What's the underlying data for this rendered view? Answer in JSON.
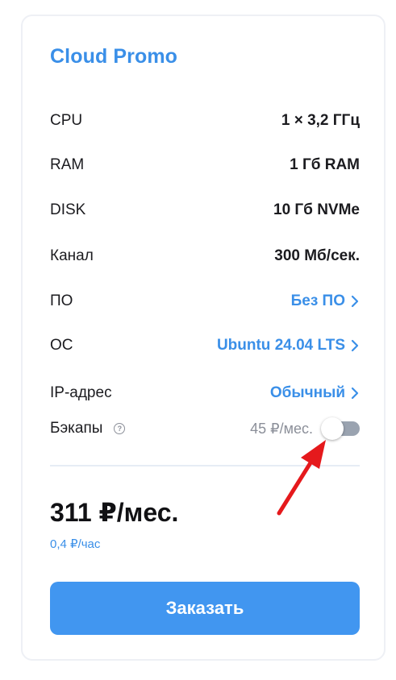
{
  "card": {
    "title": "Cloud Promo",
    "specs": [
      {
        "label": "CPU",
        "value": "1 × 3,2 ГГц"
      },
      {
        "label": "RAM",
        "value": "1 Гб RAM"
      },
      {
        "label": "DISK",
        "value": "10 Гб NVMe"
      },
      {
        "label": "Канал",
        "value": "300 Мб/сек."
      }
    ],
    "options": [
      {
        "label": "ПО",
        "value": "Без ПО"
      },
      {
        "label": "ОС",
        "value": "Ubuntu 24.04 LTS"
      },
      {
        "label": "IP-адрес",
        "value": "Обычный"
      }
    ],
    "backup": {
      "label": "Бэкапы",
      "info_icon": "?",
      "price": "45 ₽/мес.",
      "enabled": false
    },
    "price": {
      "monthly": "311 ₽/мес.",
      "hourly": "0,4 ₽/час"
    },
    "order_button": "Заказать"
  },
  "colors": {
    "accent": "#3a8fe8",
    "button": "#4196f0",
    "arrow": "#e5191c",
    "toggle_off": "#9aa3b0"
  }
}
